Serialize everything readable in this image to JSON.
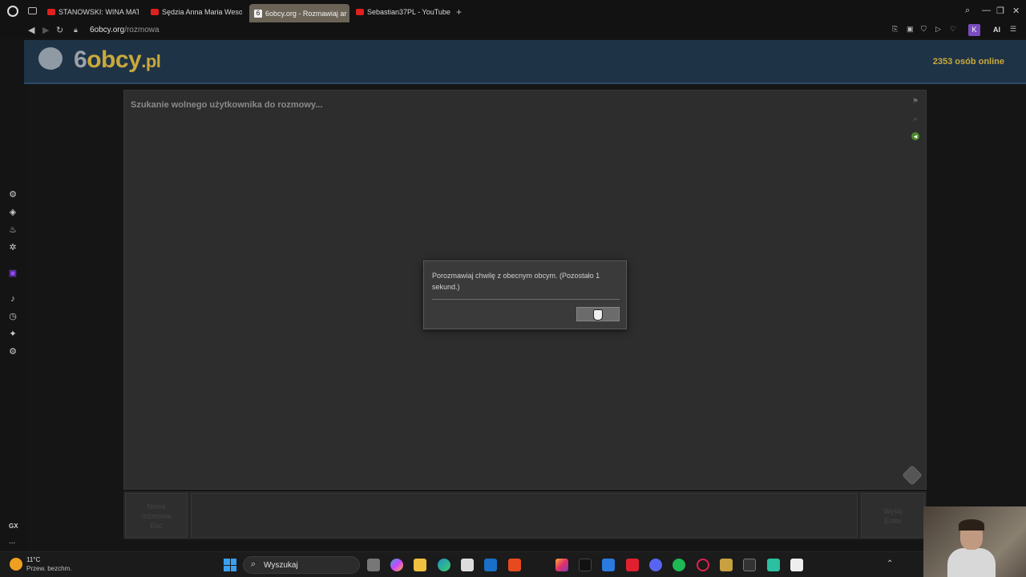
{
  "browser": {
    "tabs": [
      {
        "label": "STANOWSKI: WINA MATKI",
        "icon": "youtube-icon"
      },
      {
        "label": "Sędzia Anna Maria Wesoł",
        "icon": "youtube-icon"
      },
      {
        "label": "6obcy.org - Rozmawiaj ar",
        "icon": "6obcy-icon",
        "active": true
      },
      {
        "label": "Sebastian37PL - YouTube",
        "icon": "youtube-icon"
      }
    ],
    "new_tab": "+",
    "url_host": "6obcy.org",
    "url_path": "/rozmowa",
    "profile_initial": "K",
    "ai_label": "AI"
  },
  "site": {
    "logo_prefix": "6",
    "logo_mid": "obcy",
    "logo_suffix": ".pl",
    "online_count": "2353 osób online",
    "status": "Szukanie wolnego użytkownika do rozmowy...",
    "new_button": "Nowa\nrozmowa\nEsc",
    "send_button": "Wyślij\nEnter"
  },
  "dialog": {
    "message": "Porozmawiaj chwilę z obecnym obcym. (Pozostało 1 sekund.)"
  },
  "sidebar": {
    "gx_label": "GX",
    "more_label": "..."
  },
  "taskbar": {
    "temperature": "11°C",
    "condition": "Przew. bezchm.",
    "search_label": "Wyszukaj"
  },
  "colors": {
    "accent_gold": "#c8a93a",
    "header_blue": "#1f3347",
    "chat_bg": "#2d2d2d"
  }
}
